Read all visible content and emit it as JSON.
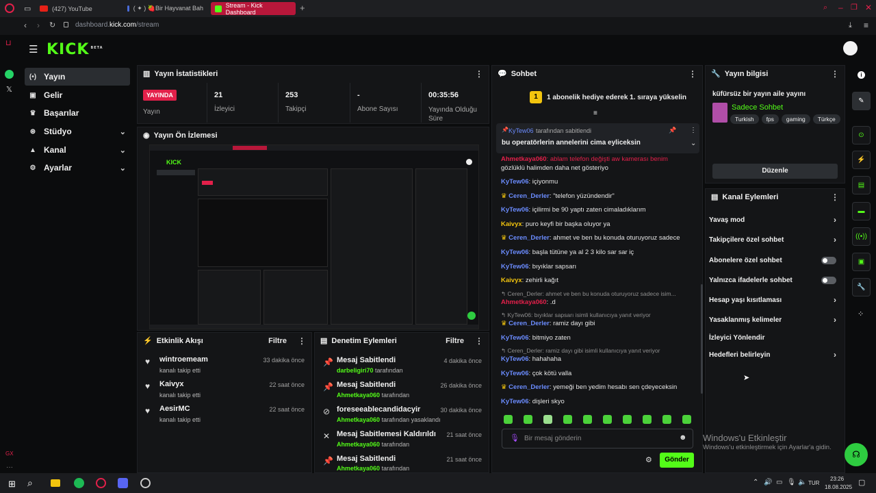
{
  "browser": {
    "tabs": [
      {
        "label": "(427) YouTube",
        "color": "#e62117"
      },
      {
        "label": "( ✦ ) 🍓Bir Hayvanat Bah",
        "color": "#4a6bd8"
      },
      {
        "label": "Stream - Kick Dashboard",
        "color": "#53fc18"
      }
    ],
    "url_prefix": "dashboard.",
    "url_domain": "kick.com",
    "url_path": "/stream"
  },
  "nav": [
    {
      "label": "Yayın",
      "icon": "(•)",
      "active": true
    },
    {
      "label": "Gelir",
      "icon": "▣"
    },
    {
      "label": "Başarılar",
      "icon": "♛"
    },
    {
      "label": "Stüdyo",
      "icon": "⊛",
      "expand": true
    },
    {
      "label": "Kanal",
      "icon": "▲",
      "expand": true
    },
    {
      "label": "Ayarlar",
      "icon": "⚙",
      "expand": true
    }
  ],
  "logo": "KICK",
  "logo_sup": "BETA",
  "stats": {
    "title": "Yayın İstatistikleri",
    "live_badge": "YAYINDA",
    "live_label": "Yayın",
    "items": [
      {
        "value": "21",
        "label": "İzleyici"
      },
      {
        "value": "253",
        "label": "Takipçi"
      },
      {
        "value": "-",
        "label": "Abone Sayısı"
      },
      {
        "value": "00:35:56",
        "label": "Yayında Olduğu Süre"
      }
    ]
  },
  "preview": {
    "title": "Yayın Ön İzlemesi"
  },
  "activity": {
    "title": "Etkinlik Akışı",
    "filter": "Filtre",
    "items": [
      {
        "name": "wintroemeam",
        "desc": "kanalı takip etti",
        "time": "33 dakika önce"
      },
      {
        "name": "Kaivyx",
        "desc": "kanalı takip etti",
        "time": "22 saat önce"
      },
      {
        "name": "AesirMC",
        "desc": "kanalı takip etti",
        "time": "22 saat önce"
      }
    ]
  },
  "moderation": {
    "title": "Denetim Eylemleri",
    "filter": "Filtre",
    "items": [
      {
        "action": "Mesaj Sabitlendi",
        "user": "darbeligiri70",
        "suffix": "tarafından",
        "time": "4 dakika önce",
        "icon": "📌"
      },
      {
        "action": "Mesaj Sabitlendi",
        "user": "Ahmetkaya060",
        "suffix": "tarafından",
        "time": "26 dakika önce",
        "icon": "📌"
      },
      {
        "action": "foreseeablecandidacyir",
        "user": "Ahmetkaya060",
        "suffix": "tarafından yasaklandı",
        "time": "30 dakika önce",
        "icon": "⊘"
      },
      {
        "action": "Mesaj Sabitlemesi Kaldırıldı",
        "user": "Ahmetkaya060",
        "suffix": "tarafından",
        "time": "21 saat önce",
        "icon": "✕"
      },
      {
        "action": "Mesaj Sabitlendi",
        "user": "Ahmetkaya060",
        "suffix": "tarafından",
        "time": "21 saat önce",
        "icon": "📌"
      }
    ]
  },
  "chat": {
    "title": "Sohbet",
    "gift_banner": "1 abonelik hediye ederek 1. sıraya yükselin",
    "gift_rank": "1",
    "pinned_by": "KyTew06",
    "pinned_by_suffix": "tarafından sabitlendi",
    "pinned_text": "bu operatörlerin annelerini cima eyliceksin",
    "input_placeholder": "Bir mesaj gönderin",
    "send": "Gönder",
    "messages": [
      {
        "user": "Ahmetkaya060",
        "text": ": ablam telefon değişti aw kamerası benim",
        "color": "#e3204a",
        "partial": true
      },
      {
        "user": "",
        "text": "gözlüklü halimden daha net gösteriyo",
        "color": "#e5e5e5"
      },
      {
        "user": "KyTew06",
        "text": ": içiyonmu",
        "color": "#6b8cff"
      },
      {
        "user": "Ceren_Derler",
        "text": ": \"telefon yüzündendir\"",
        "color": "#6b8cff",
        "badge": true
      },
      {
        "user": "KyTew06",
        "text": ": içilirmi be 90 yaptı zaten cimaladıklarım",
        "color": "#6b8cff"
      },
      {
        "user": "Kaivyx",
        "text": ": puro keyfi bir başka oluyor ya",
        "color": "#f2c40e"
      },
      {
        "user": "Ceren_Derler",
        "text": ": ahmet ve ben bu konuda oturuyoruz sadece",
        "color": "#6b8cff",
        "badge": true
      },
      {
        "user": "KyTew06",
        "text": ": başla tütüne ya al 2 3 kilo sar sar iç",
        "color": "#6b8cff"
      },
      {
        "user": "KyTew06",
        "text": ": bıyıklar sapsarı",
        "color": "#6b8cff"
      },
      {
        "user": "Kaivyx",
        "text": ": zehirli kağıt",
        "color": "#f2c40e"
      }
    ],
    "reply1": "Ceren_Derler: ahmet ve ben bu konuda oturuyoruz sadece",
    "reply1_tail": "isim...",
    "msg_after1": {
      "user": "Ahmetkaya060",
      "text": ": .d",
      "color": "#e3204a"
    },
    "reply2": "KyTew06: bıyıklar sapsarı isimli kullanıcıya yanıt veriyor",
    "msgs2": [
      {
        "user": "Ceren_Derler",
        "text": ": ramiz dayı gibi",
        "color": "#6b8cff",
        "badge": true
      },
      {
        "user": "KyTew06",
        "text": ": bitmiyo zaten",
        "color": "#6b8cff"
      }
    ],
    "reply3": "Ceren_Derler: ramiz dayı gibi isimli kullanıcıya yanıt veriyor",
    "msgs3": [
      {
        "user": "KyTew06",
        "text": ": hahahaha",
        "color": "#6b8cff"
      },
      {
        "user": "KyTew06",
        "text": ": çok kötü valla",
        "color": "#6b8cff"
      },
      {
        "user": "Ceren_Derler",
        "text": ": yemeği ben yedim hesabı sen çdeyeceksin",
        "color": "#6b8cff",
        "badge": true
      },
      {
        "user": "KyTew06",
        "text": ": dişleri skyo",
        "color": "#6b8cff"
      }
    ]
  },
  "streaminfo": {
    "title": "Yayın bilgisi",
    "stream_title": "küfürsüz bir yayın aile yayını",
    "category": "Sadece Sohbet",
    "tags": [
      "Turkish",
      "fps",
      "gaming",
      "Türkçe"
    ],
    "edit": "Düzenle"
  },
  "channel": {
    "title": "Kanal Eylemleri",
    "items": [
      {
        "label": "Yavaş mod",
        "kind": "arrow"
      },
      {
        "label": "Takipçilere özel sohbet",
        "kind": "arrow"
      },
      {
        "label": "Abonelere özel sohbet",
        "kind": "toggle"
      },
      {
        "label": "Yalnızca ifadelerle sohbet",
        "kind": "toggle"
      },
      {
        "label": "Hesap yaşı kısıtlaması",
        "kind": "arrow"
      },
      {
        "label": "Yasaklanmış kelimeler",
        "kind": "arrow"
      },
      {
        "label": "İzleyici Yönlendir",
        "kind": "none"
      },
      {
        "label": "Hedefleri belirleyin",
        "kind": "arrow"
      }
    ]
  },
  "windows": {
    "activate_title": "Windows'u Etkinleştir",
    "activate_sub": "Windows'u etkinleştirmek için Ayarlar'a gidin.",
    "lang": "TUR",
    "time": "23:26",
    "date": "18.08.2025"
  },
  "colors": {
    "accent": "#53fc18",
    "live": "#e3204a"
  }
}
